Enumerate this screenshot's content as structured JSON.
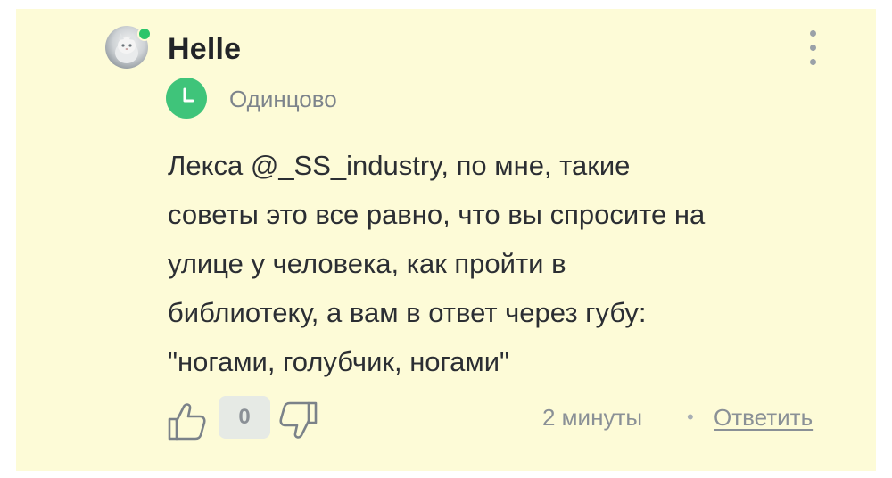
{
  "comment": {
    "author": {
      "name": "Helle",
      "avatar": "cat-avatar",
      "online": true,
      "online_color": "#2bc56a",
      "badge_icon": "clock-icon",
      "badge_color": "#3fc47a",
      "city": "Одинцово"
    },
    "text_lines": [
      "Лекса @_SS_industry, по мне, такие",
      "советы это все равно, что вы спросите на",
      "улице у человека, как пройти в",
      "библиотеку, а вам в ответ через губу:",
      "\"ногами, голубчик, ногами\""
    ],
    "footer": {
      "like_icon": "thumbs-up-icon",
      "score": "0",
      "dislike_icon": "thumbs-down-icon",
      "time": "2 минуты",
      "separator": "•",
      "reply_label": "Ответить"
    },
    "menu_icon": "more-vertical-icon",
    "background_color": "#fdfbd7"
  }
}
